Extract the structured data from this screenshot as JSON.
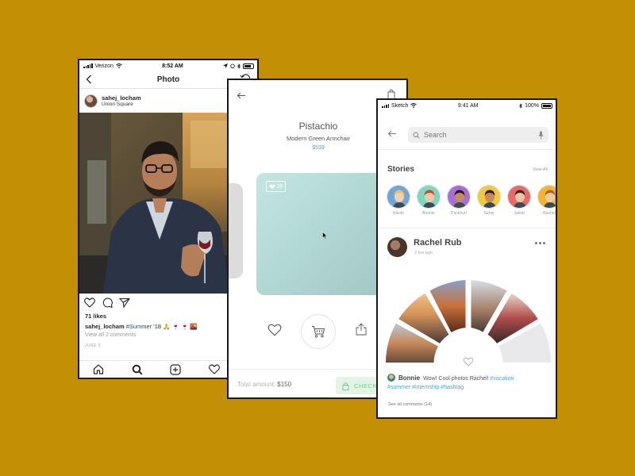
{
  "colors": {
    "background": "#C38F04",
    "link_blue": "#1d4c8a",
    "price_blue": "#5a9ad8",
    "checkout_green": "#7bc58a",
    "hashtag": "#44a8d8"
  },
  "instagram": {
    "status": {
      "carrier": "Verizon",
      "time": "8:52 AM"
    },
    "nav": {
      "title": "Photo"
    },
    "user": {
      "username": "sahej_locham",
      "location": "Union Square"
    },
    "likes": "71 likes",
    "caption": {
      "username": "sahej_locham",
      "hashtag": "#Summer",
      "text": " '18 🙏 🍷 🍷 🌇"
    },
    "view_comments": "View all 2 comments",
    "date": "JUNE 5",
    "icons": [
      "heart-icon",
      "comment-icon",
      "send-icon",
      "home-icon",
      "search-icon",
      "add-icon",
      "activity-icon"
    ]
  },
  "shop": {
    "product_name": "Pistachio",
    "product_sub": "Modern Green Armchair",
    "price": "$539",
    "likes": "26",
    "total_label": "Total amount:",
    "total_value": "$150",
    "checkout_label": "CHECK",
    "icons": [
      "back-arrow-icon",
      "shopping-bag-icon",
      "heart-icon",
      "cart-icon",
      "share-icon",
      "lock-icon"
    ]
  },
  "social": {
    "status": {
      "carrier": "Sketch",
      "time": "9:41 AM",
      "battery": "100%"
    },
    "search_placeholder": "Search",
    "stories_title": "Stories",
    "view_all": "View All",
    "stories": [
      {
        "name": "Nikole",
        "bg": "#6fa6d6",
        "hair": "#e8c26a",
        "skin": "#f2d0b4"
      },
      {
        "name": "Bonnie",
        "bg": "#7fd6c2",
        "hair": "#c94a2f",
        "skin": "#f2c9a8"
      },
      {
        "name": "Pankhuri",
        "bg": "#a56fd6",
        "hair": "#2a1e1a",
        "skin": "#c88a62"
      },
      {
        "name": "Sahej",
        "bg": "#f1c93a",
        "hair": "#2a1e1a",
        "skin": "#c48a60"
      },
      {
        "name": "Jakob",
        "bg": "#e86a6a",
        "hair": "#3a2a22",
        "skin": "#f0c4a4"
      },
      {
        "name": "Rachel",
        "bg": "#f3b431",
        "hair": "#a8662a",
        "skin": "#f0c8a8"
      }
    ],
    "post": {
      "name": "Rachel Rub",
      "time": "2 hrs ago"
    },
    "comment": {
      "name": "Bonnie",
      "text": "Wow! Cool photos Rachel!",
      "tags_inline": "#vacation",
      "tags_line2": "#summer #internship #hashtag"
    },
    "see_all_comments": "See all comments (14)"
  }
}
